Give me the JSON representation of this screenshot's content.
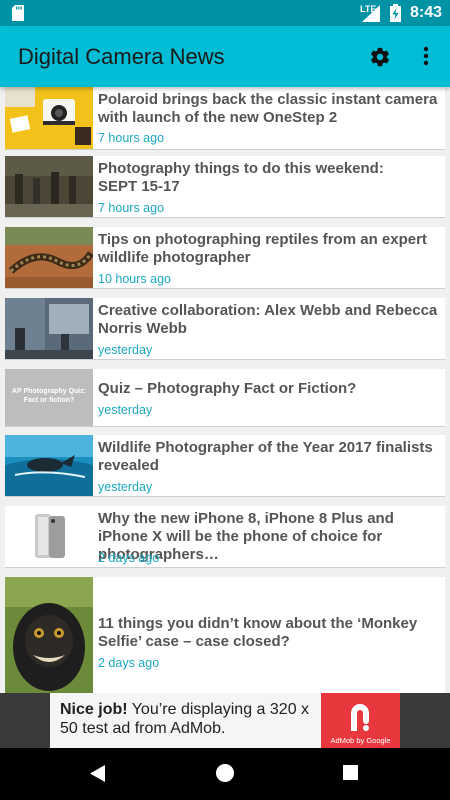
{
  "status_bar": {
    "network": "LTE",
    "time": "8:43"
  },
  "app_bar": {
    "title": "Digital Camera News",
    "settings_icon": "gear-icon",
    "overflow_icon": "more-vert-icon"
  },
  "feed": {
    "items": [
      {
        "title": "Polaroid brings back the classic instant camera with launch of the new OneStep 2",
        "time": "7 hours ago"
      },
      {
        "title": "Photography things to do this weekend:\nSEPT 15-17",
        "time": "7 hours ago"
      },
      {
        "title": "Tips on photographing reptiles from an expert wildlife photographer",
        "time": "10 hours ago"
      },
      {
        "title": "Creative collaboration: Alex Webb and Rebecca Norris Webb",
        "time": "yesterday"
      },
      {
        "title": "Quiz – Photography Fact or Fiction?",
        "time": "yesterday",
        "thumb_text": "AP Photography Quiz: Fact or fiction?"
      },
      {
        "title": "Wildlife Photographer of the Year 2017 finalists revealed",
        "time": "yesterday"
      },
      {
        "title": "Why the new iPhone 8, iPhone 8 Plus and iPhone X will be the phone of choice for photographers…",
        "time": "2 days ago"
      },
      {
        "title": "11 things you didn’t know about the ‘Monkey Selfie’ case – case closed?",
        "time": "2 days ago"
      }
    ]
  },
  "ad": {
    "bold": "Nice job!",
    "text": " You’re displaying a 320 x 50 test ad from AdMob.",
    "caption": "AdMob by Google",
    "logo_color": "#e8383d"
  },
  "nav": {
    "back_icon": "back-icon",
    "home_icon": "home-icon",
    "recents_icon": "recents-icon"
  },
  "colors": {
    "status_bar": "#0093a6",
    "app_bar": "#00bcd4",
    "timestamp": "#1ca8c2"
  }
}
